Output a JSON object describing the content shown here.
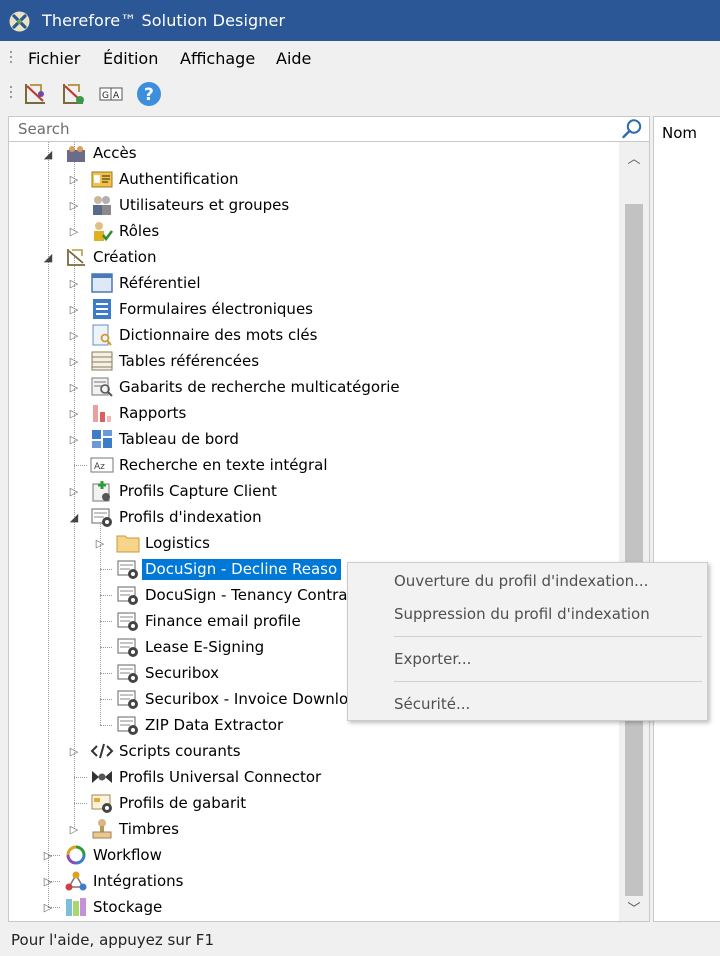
{
  "window": {
    "title": "Therefore™ Solution Designer"
  },
  "menu": [
    "Fichier",
    "Édition",
    "Affichage",
    "Aide"
  ],
  "toolbar": [
    {
      "icon": "designer-icon"
    },
    {
      "icon": "designer-alt-icon"
    },
    {
      "icon": "font-icon"
    },
    {
      "icon": "help-icon"
    }
  ],
  "search": {
    "placeholder": "Search",
    "value": ""
  },
  "right_panel": {
    "column_header": "Nom"
  },
  "tree": {
    "acces": "Accès",
    "authentification": "Authentification",
    "utilisateurs": "Utilisateurs et groupes",
    "roles": "Rôles",
    "creation": "Création",
    "referentiel": "Référentiel",
    "formulaires": "Formulaires électroniques",
    "dictionnaire": "Dictionnaire des mots clés",
    "tables": "Tables référencées",
    "gabarits": "Gabarits de recherche multicatégorie",
    "rapports": "Rapports",
    "tableau": "Tableau de bord",
    "recherche": "Recherche en texte intégral",
    "capture": "Profils Capture Client",
    "indexation": "Profils d'indexation",
    "logistics": "Logistics",
    "docusign_decline": "DocuSign - Decline Reaso",
    "docusign_tenancy": "DocuSign - Tenancy Contra",
    "finance": "Finance email profile",
    "lease": "Lease E-Signing",
    "securibox": "Securibox",
    "securibox_invoice": "Securibox - Invoice Downlo",
    "zip": "ZIP Data Extractor",
    "scripts": "Scripts courants",
    "universal": "Profils Universal Connector",
    "profils_gabarit": "Profils de gabarit",
    "timbres": "Timbres",
    "workflow": "Workflow",
    "integrations": "Intégrations",
    "stockage": "Stockage"
  },
  "context_menu": {
    "open": "Ouverture du profil d'indexation...",
    "delete": "Suppression du profil d'indexation",
    "export": "Exporter...",
    "security": "Sécurité..."
  },
  "status": "Pour l'aide, appuyez sur F1",
  "colors": {
    "titlebar": "#2b5797",
    "selection": "#0078d7",
    "menu_bg": "#f0f0f0"
  }
}
